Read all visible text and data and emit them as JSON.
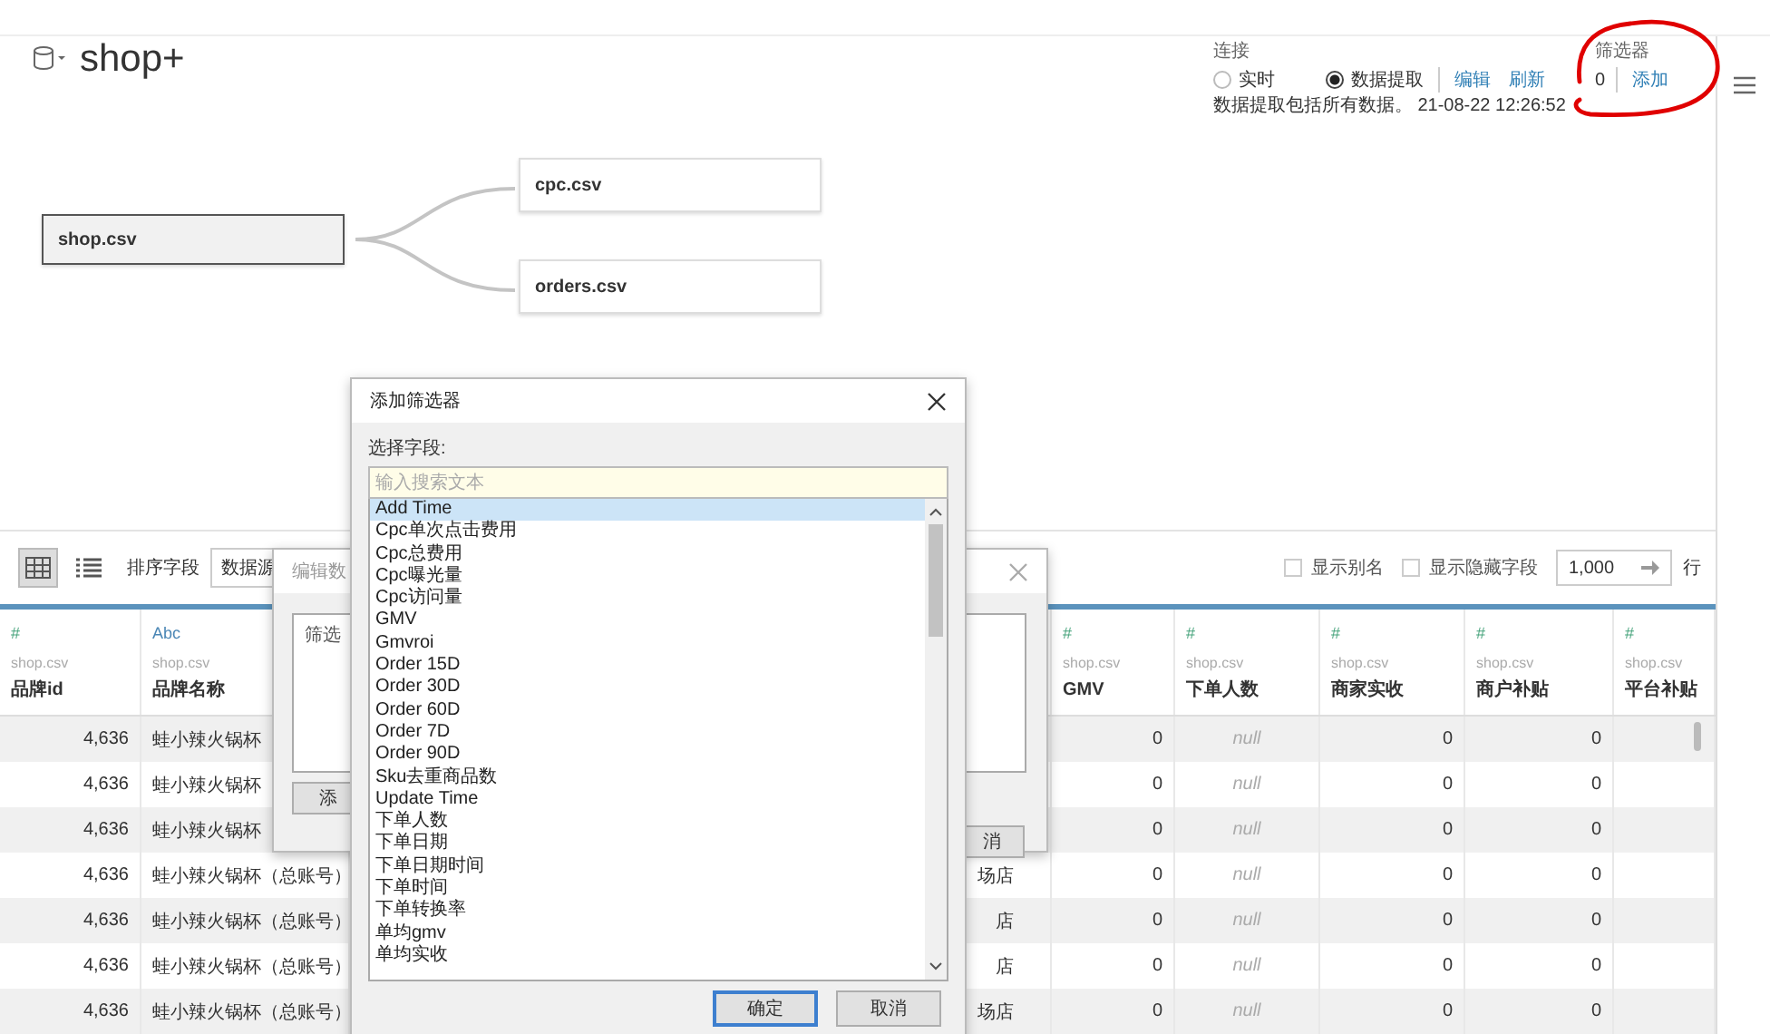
{
  "app": {
    "title": "shop+"
  },
  "connection": {
    "label": "连接",
    "options": [
      {
        "label": "实时",
        "selected": false
      },
      {
        "label": "数据提取",
        "selected": true
      }
    ],
    "links": [
      "编辑",
      "刷新"
    ],
    "status": "数据提取包括所有数据。 21-08-22 12:26:52"
  },
  "filters": {
    "label": "筛选器",
    "count": "0",
    "add": "添加"
  },
  "canvas": {
    "primary": {
      "label": "shop.csv",
      "selected": true
    },
    "joined": [
      {
        "label": "cpc.csv",
        "selected": false
      },
      {
        "label": "orders.csv",
        "selected": false
      }
    ]
  },
  "grid_toolbar": {
    "views": [
      {
        "kind": "grid",
        "selected": true
      },
      {
        "kind": "list",
        "selected": false
      }
    ],
    "sort_label": "排序字段",
    "sort_value": "数据源",
    "show_alias": {
      "label": "显示别名",
      "checked": false
    },
    "show_hidden": {
      "label": "显示隐藏字段",
      "checked": false
    },
    "row_limit": "1,000",
    "rows_unit": "行"
  },
  "table": {
    "columns": [
      {
        "type": "#",
        "source": "shop.csv",
        "name": "品牌id",
        "kind": "number"
      },
      {
        "type": "Abc",
        "source": "shop.csv",
        "name": "品牌名称",
        "kind": "text"
      },
      {
        "kind": "tail"
      },
      {
        "type": "#",
        "source": "shop.csv",
        "name": "GMV",
        "kind": "number"
      },
      {
        "type": "#",
        "source": "shop.csv",
        "name": "下单人数",
        "kind": "null"
      },
      {
        "type": "#",
        "source": "shop.csv",
        "name": "商家实收",
        "kind": "number"
      },
      {
        "type": "#",
        "source": "shop.csv",
        "name": "商户补贴",
        "kind": "number"
      },
      {
        "type": "#",
        "source": "shop.csv",
        "name": "平台补贴",
        "kind": "number"
      }
    ],
    "rows": [
      [
        "4,636",
        "蛙小辣火锅杯",
        null,
        "0",
        "null",
        "0",
        "0",
        null
      ],
      [
        "4,636",
        "蛙小辣火锅杯",
        null,
        "0",
        "null",
        "0",
        "0",
        null
      ],
      [
        "4,636",
        "蛙小辣火锅杯",
        null,
        "0",
        "null",
        "0",
        "0",
        null
      ],
      [
        "4,636",
        "蛙小辣火锅杯（总账号）",
        "场店",
        "0",
        "null",
        "0",
        "0",
        null
      ],
      [
        "4,636",
        "蛙小辣火锅杯（总账号）",
        "店",
        "0",
        "null",
        "0",
        "0",
        null
      ],
      [
        "4,636",
        "蛙小辣火锅杯（总账号）",
        "店",
        "0",
        "null",
        "0",
        "0",
        null
      ],
      [
        "4,636",
        "蛙小辣火锅杯（总账号）",
        "场店",
        "0",
        "null",
        "0",
        "0",
        null
      ]
    ]
  },
  "edit_filter_dialog": {
    "title": "编辑数",
    "list_item": "筛选",
    "add_button": "添",
    "cancel_button": "消"
  },
  "add_filter_dialog": {
    "title": "添加筛选器",
    "field_label": "选择字段:",
    "search": {
      "placeholder": "输入搜索文本"
    },
    "fields": [
      {
        "label": "Add Time",
        "selected": true
      },
      {
        "label": "Cpc单次点击费用",
        "selected": false
      },
      {
        "label": "Cpc总费用",
        "selected": false
      },
      {
        "label": "Cpc曝光量",
        "selected": false
      },
      {
        "label": "Cpc访问量",
        "selected": false
      },
      {
        "label": "GMV",
        "selected": false
      },
      {
        "label": "Gmvroi",
        "selected": false
      },
      {
        "label": "Order 15D",
        "selected": false
      },
      {
        "label": "Order 30D",
        "selected": false
      },
      {
        "label": "Order 60D",
        "selected": false
      },
      {
        "label": "Order 7D",
        "selected": false
      },
      {
        "label": "Order 90D",
        "selected": false
      },
      {
        "label": "Sku去重商品数",
        "selected": false
      },
      {
        "label": "Update Time",
        "selected": false
      },
      {
        "label": "下单人数",
        "selected": false
      },
      {
        "label": "下单日期",
        "selected": false
      },
      {
        "label": "下单日期时间",
        "selected": false
      },
      {
        "label": "下单时间",
        "selected": false
      },
      {
        "label": "下单转换率",
        "selected": false
      },
      {
        "label": "单均gmv",
        "selected": false
      },
      {
        "label": "单均实收",
        "selected": false
      }
    ],
    "ok_button": "确定",
    "cancel_button": "取消"
  }
}
